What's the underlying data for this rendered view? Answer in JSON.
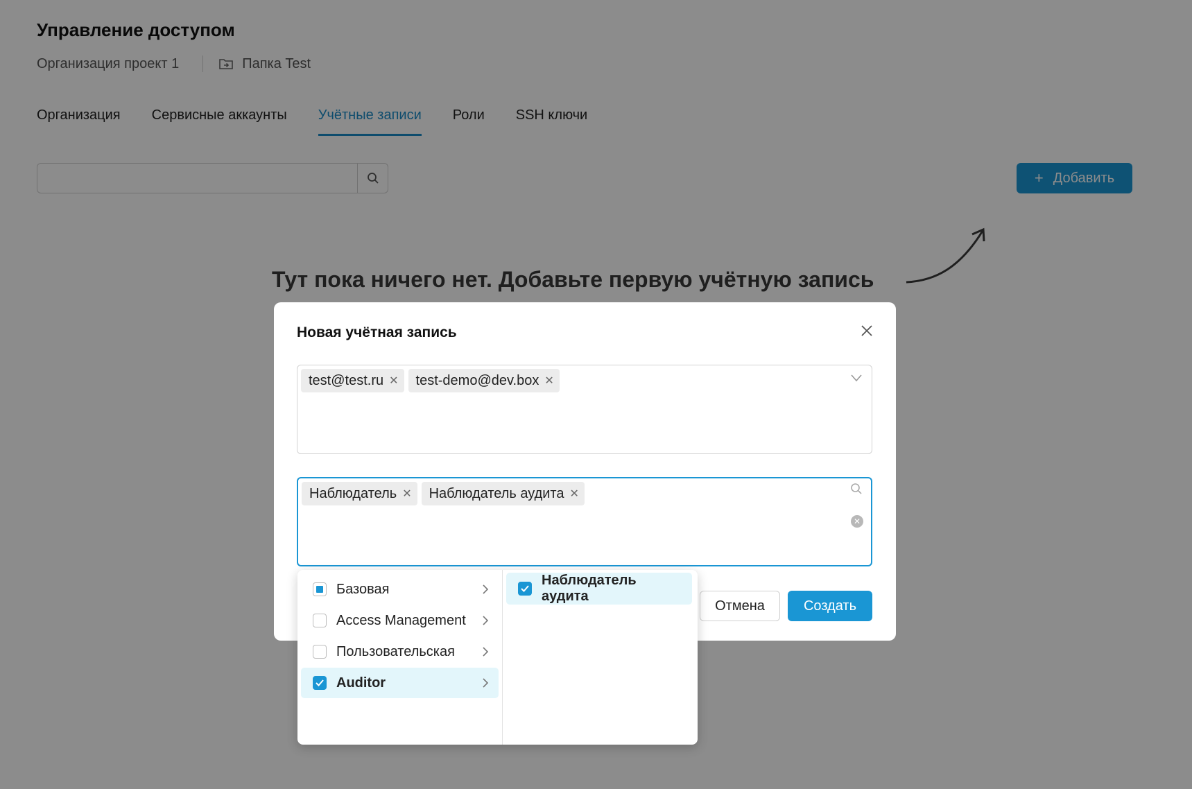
{
  "page": {
    "title": "Управление доступом",
    "breadcrumb": {
      "org": "Организация проект 1",
      "folder": "Папка Test",
      "folder_icon": "folder-arrow-icon"
    }
  },
  "tabs": [
    {
      "label": "Организация",
      "active": false
    },
    {
      "label": "Сервисные аккаунты",
      "active": false
    },
    {
      "label": "Учётные записи",
      "active": true
    },
    {
      "label": "Роли",
      "active": false
    },
    {
      "label": "SSH ключи",
      "active": false
    }
  ],
  "toolbar": {
    "search_value": "",
    "search_icon": "search-icon",
    "add_label": "Добавить",
    "add_icon": "plus-icon"
  },
  "empty_state": {
    "text": "Тут пока ничего нет. Добавьте первую учётную запись"
  },
  "modal": {
    "title": "Новая учётная запись",
    "users_field": {
      "chips": [
        "test@test.ru",
        "test-demo@dev.box"
      ]
    },
    "roles_field": {
      "chips": [
        "Наблюдатель",
        "Наблюдатель аудита"
      ]
    },
    "cancel_label": "Отмена",
    "create_label": "Создать"
  },
  "dropdown": {
    "groups": [
      {
        "label": "Базовая",
        "state": "partial"
      },
      {
        "label": "Access Management",
        "state": "unchecked"
      },
      {
        "label": "Пользовательская",
        "state": "unchecked"
      },
      {
        "label": "Auditor",
        "state": "checked"
      }
    ],
    "roles": [
      {
        "label": "Наблюдатель аудита",
        "state": "checked"
      }
    ]
  },
  "colors": {
    "accent": "#1a96d4",
    "selected_bg": "#e3f6fb",
    "overlay": "rgba(0,0,0,0.45)"
  }
}
